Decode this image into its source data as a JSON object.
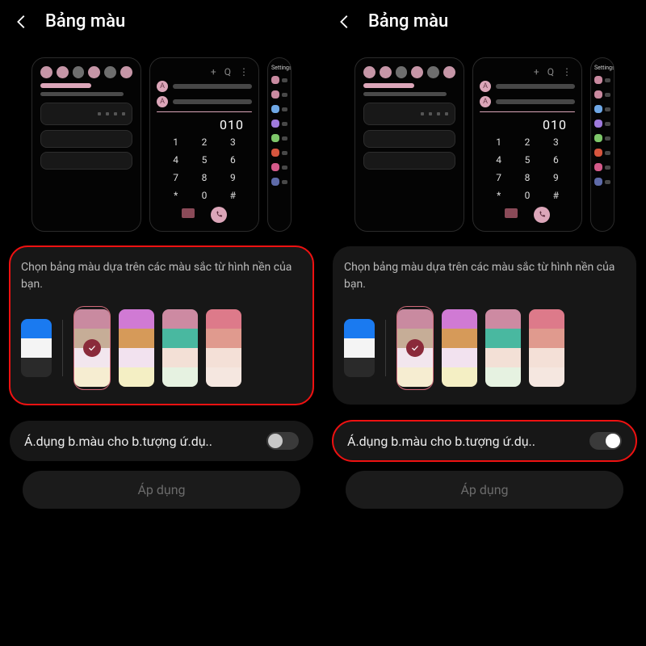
{
  "header": {
    "title": "Bảng màu"
  },
  "preview": {
    "plus": "+",
    "q": "Q",
    "more_glyph": "⋮",
    "dialer_display": "010",
    "keys": [
      "1",
      "2",
      "3",
      "4",
      "5",
      "6",
      "7",
      "8",
      "9",
      "*",
      "0",
      "#"
    ],
    "settings_label": "Settings",
    "side_icons": [
      "#c98aa0",
      "#c98aa0",
      "#6fa8e6",
      "#9f7adc",
      "#7ec76a",
      "#d6553e",
      "#d45a8a",
      "#5e6aa8"
    ]
  },
  "palette_section": {
    "description": "Chọn bảng màu dựa trên các màu sắc từ hình nền của bạn.",
    "basic": [
      "#1a7af0",
      "#f4f4f4",
      "#2a2a2a"
    ],
    "options": [
      {
        "colors": [
          "#c98aa0",
          "#c6ad97",
          "#f2e6ee",
          "#f6edd1"
        ],
        "selected": true
      },
      {
        "colors": [
          "#d07ad4",
          "#d69a59",
          "#f2e2ef",
          "#f4efc4"
        ],
        "selected": false
      },
      {
        "colors": [
          "#cd8aa2",
          "#49b8a0",
          "#f3e0d6",
          "#e6f2e1"
        ],
        "selected": false
      },
      {
        "colors": [
          "#dd7a8a",
          "#e09a8e",
          "#f4e0d7",
          "#f5e7e0"
        ],
        "selected": false
      }
    ]
  },
  "toggle": {
    "label": "Á.dụng b.màu cho b.tượng ứ.dụ.."
  },
  "apply": {
    "label": "Áp dụng"
  },
  "left_highlight": "palette",
  "right_highlight": "toggle"
}
